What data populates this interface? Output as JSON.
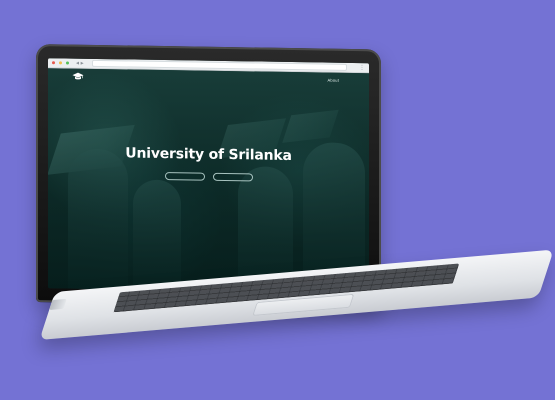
{
  "browser": {
    "buttons": [
      "close",
      "minimize",
      "maximize"
    ],
    "nav_icons": [
      "back-icon",
      "forward-icon"
    ],
    "menu_icon": "browser-menu-icon"
  },
  "site": {
    "logo_icon": "graduation-cap-icon",
    "nav": {
      "about_label": "About"
    },
    "hero": {
      "title": "University of Srilanka",
      "subtitle": "",
      "primary_button": "",
      "secondary_button": ""
    }
  },
  "colors": {
    "background": "#7472d4",
    "hero_overlay": "#1b3d39"
  }
}
